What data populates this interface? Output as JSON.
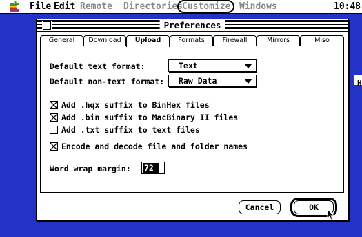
{
  "menubar": {
    "items": [
      {
        "label": "File",
        "enabled": true
      },
      {
        "label": "Edit",
        "enabled": true
      },
      {
        "label": "Remote",
        "enabled": false
      },
      {
        "label": "Directories",
        "enabled": false
      },
      {
        "label": "Customize",
        "enabled": false,
        "highlighted": true
      },
      {
        "label": "Windows",
        "enabled": false
      }
    ],
    "clock": "10:48"
  },
  "dialog": {
    "title": "Preferences",
    "tabs": [
      "General",
      "Download",
      "Upload",
      "Formats",
      "Firewall",
      "Mirrors",
      "Miso"
    ],
    "active_tab": "Upload",
    "text_format_label": "Default text format:",
    "text_format_value": "Text",
    "nontext_format_label": "Default non-text format:",
    "nontext_format_value": "Raw Data",
    "options": [
      {
        "label": "Add .hqx suffix to BinHex files",
        "checked": true
      },
      {
        "label": "Add .bin suffix to MacBinary II files",
        "checked": true
      },
      {
        "label": "Add .txt suffix to text files",
        "checked": false
      },
      {
        "label": "Encode and decode file and folder names",
        "checked": true
      }
    ],
    "word_wrap_label": "Word wrap margin:",
    "word_wrap_value": "72",
    "cancel_label": "Cancel",
    "ok_label": "OK"
  },
  "colors": {
    "desktop": "#2333c8",
    "disabled_menu": "#8a8a8a"
  },
  "edge_glyph": "H"
}
